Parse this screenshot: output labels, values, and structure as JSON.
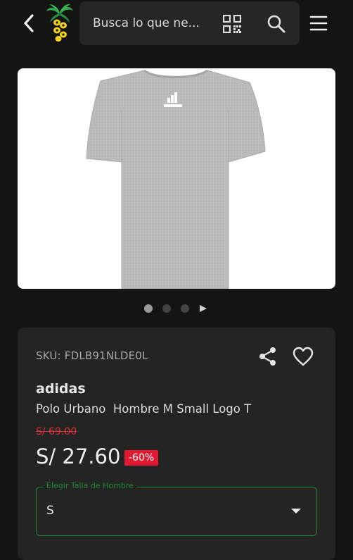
{
  "header": {
    "search_placeholder": "Busca lo que ne...",
    "icons": [
      "back-arrow-icon",
      "brand-logo",
      "qr-code-icon",
      "search-icon",
      "hamburger-menu-icon"
    ]
  },
  "carousel": {
    "dot_count": 3,
    "active_index": 0,
    "play_icon": "play-icon"
  },
  "product": {
    "sku": "SKU: FDLB91NLDE0L",
    "brand": "adidas",
    "name": "Polo Urbano  Hombre M Small Logo T",
    "old_price": "S/ 69.00",
    "price": "S/ 27.60",
    "discount": "-60%",
    "actions": [
      "share-icon",
      "heart-icon"
    ]
  },
  "size_select": {
    "label": "Elegir Talla de Hombre",
    "value": "S"
  },
  "colors": {
    "background": "#141414",
    "card": "#242424",
    "accent_green": "#1f8a36",
    "discount_red": "#e11931",
    "old_price_red": "#d6303a"
  }
}
